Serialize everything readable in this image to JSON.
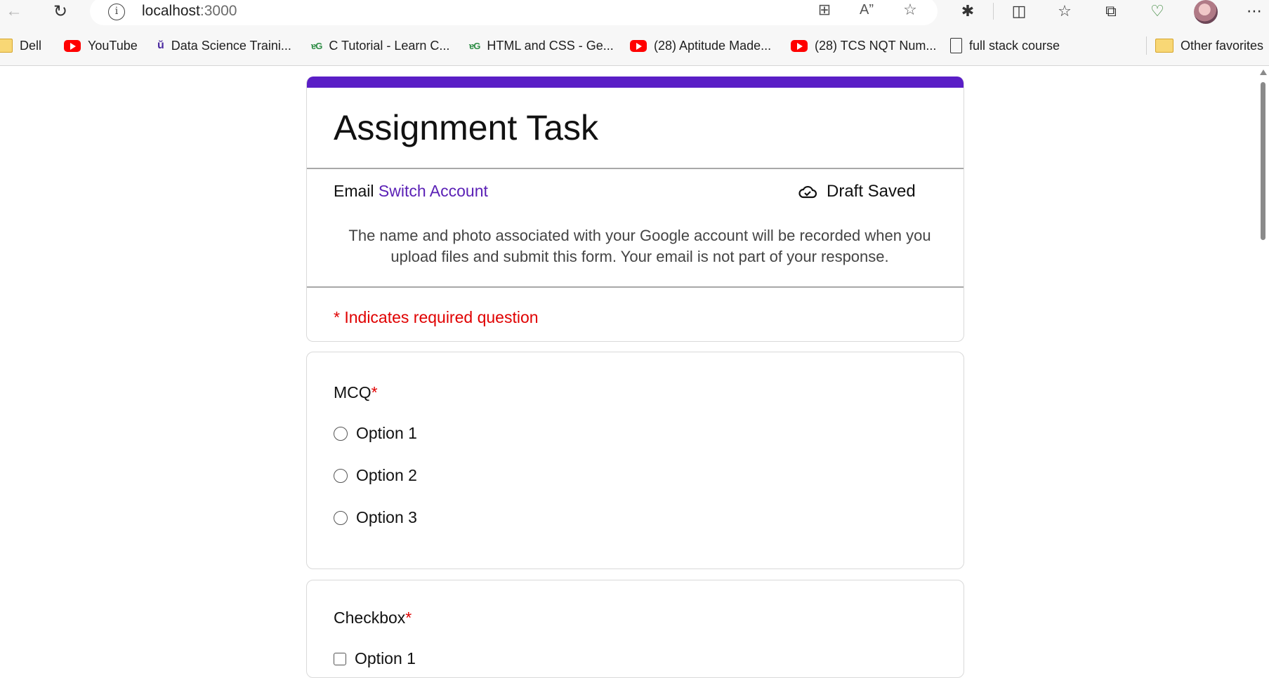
{
  "browser": {
    "url_host": "localhost",
    "url_port": ":3000",
    "bookmarks": [
      {
        "label": "Dell",
        "icon": "folder-icon"
      },
      {
        "label": "YouTube",
        "icon": "youtube-icon"
      },
      {
        "label": "Data Science Traini...",
        "icon": "upgrad-icon"
      },
      {
        "label": "C Tutorial - Learn C...",
        "icon": "gfg-icon"
      },
      {
        "label": "HTML and CSS - Ge...",
        "icon": "gfg-icon"
      },
      {
        "label": "(28) Aptitude Made...",
        "icon": "youtube-icon"
      },
      {
        "label": "(28) TCS NQT Num...",
        "icon": "youtube-icon"
      },
      {
        "label": "full stack course",
        "icon": "document-icon"
      },
      {
        "label": "Other favorites",
        "icon": "folder-icon"
      }
    ]
  },
  "form": {
    "title": "Assignment Task",
    "email_label": "Email",
    "switch_account": "Switch Account",
    "draft_status": "Draft Saved",
    "notice": "The name and photo associated with your Google account will be recorded when you upload files and submit this form. Your email is not part of your response.",
    "required_note": "* Indicates required question",
    "accent_color": "#5a1ec6",
    "questions": [
      {
        "title": "MCQ",
        "required_mark": "*",
        "type": "radio",
        "options": [
          "Option 1",
          "Option 2",
          "Option 3"
        ]
      },
      {
        "title": "Checkbox",
        "required_mark": "*",
        "type": "checkbox",
        "options": [
          "Option 1"
        ]
      }
    ]
  }
}
